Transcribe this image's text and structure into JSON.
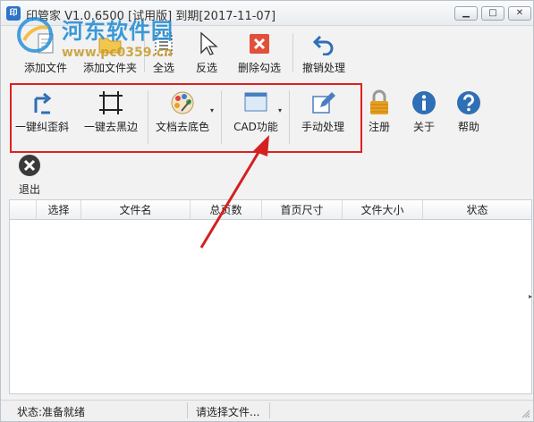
{
  "window": {
    "title": "印管家 V1.0.6500 [试用版] 到期[2017-11-07]",
    "app_icon_text": "印",
    "minimize_symbol": "▁",
    "maximize_symbol": "□",
    "close_symbol": "✕"
  },
  "watermark": {
    "site_name": "河东软件园",
    "url": "www.pc0359.cn"
  },
  "toolbar_row1": [
    {
      "label": "添加文件",
      "icon": "add-file-icon"
    },
    {
      "label": "添加文件夹",
      "icon": "add-folder-icon"
    },
    {
      "label": "全选",
      "icon": "select-all-icon"
    },
    {
      "label": "反选",
      "icon": "invert-selection-icon"
    },
    {
      "label": "删除勾选",
      "icon": "delete-checked-icon"
    },
    {
      "label": "撤销处理",
      "icon": "undo-icon"
    }
  ],
  "toolbar_row2": [
    {
      "label": "一键纠歪斜",
      "icon": "deskew-icon"
    },
    {
      "label": "一键去黑边",
      "icon": "remove-black-border-icon"
    },
    {
      "label": "文档去底色",
      "icon": "remove-background-color-icon",
      "has_dropdown": true
    },
    {
      "label": "CAD功能",
      "icon": "cad-icon",
      "has_dropdown": true
    },
    {
      "label": "手动处理",
      "icon": "manual-edit-icon"
    },
    {
      "label": "注册",
      "icon": "lock-icon"
    },
    {
      "label": "关于",
      "icon": "info-icon"
    },
    {
      "label": "帮助",
      "icon": "help-icon"
    }
  ],
  "toolbar_row3": [
    {
      "label": "退出",
      "icon": "exit-icon"
    }
  ],
  "dropdown_caret": "▾",
  "table": {
    "columns": [
      "",
      "选择",
      "文件名",
      "总页数",
      "首页尺寸",
      "文件大小",
      "状态"
    ],
    "rows": []
  },
  "statusbar": {
    "status": "状态:准备就绪",
    "message": "请选择文件..."
  },
  "colors": {
    "highlight_box": "#e02020",
    "annotation_arrow": "#d42020",
    "accent_blue": "#2a74c9"
  }
}
